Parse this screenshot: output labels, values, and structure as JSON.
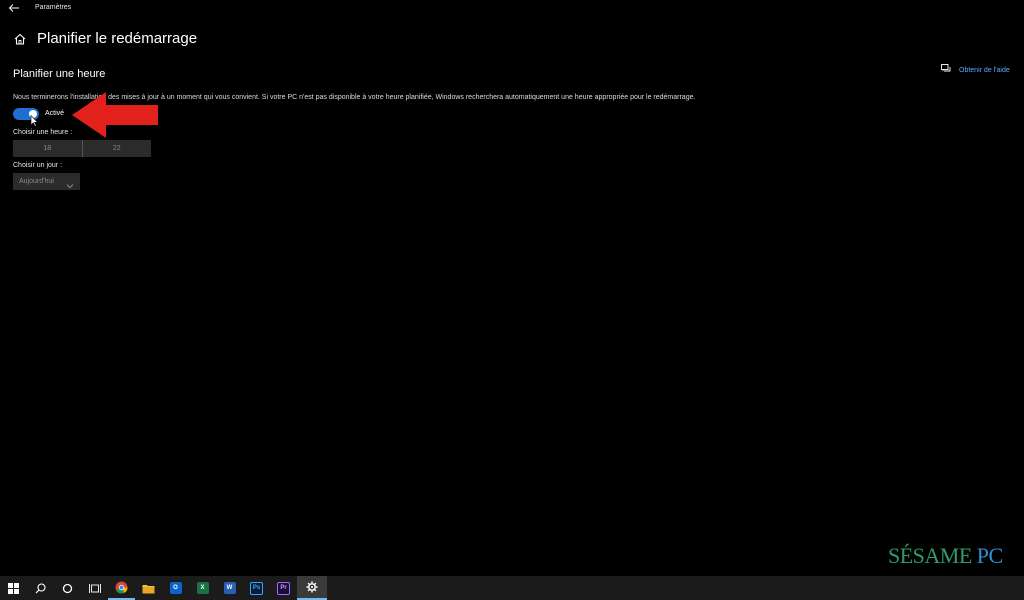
{
  "window": {
    "title": "Paramètres"
  },
  "page": {
    "title": "Planifier le redémarrage"
  },
  "section": {
    "title": "Planifier une heure"
  },
  "help": {
    "label": "Obtenir de l'aide"
  },
  "description": "Nous terminerons l'installation des mises à jour à un moment qui vous convient. Si votre PC n'est pas disponible à votre heure planifiée, Windows recherchera automatiquement une heure appropriée pour le redémarrage.",
  "toggle": {
    "label": "Activé",
    "on": true
  },
  "time": {
    "label": "Choisir une heure :",
    "hour": "18",
    "minute": "22"
  },
  "day": {
    "label": "Choisir un jour :",
    "value": "Aujourd'hui"
  },
  "watermark": {
    "part1": "SÉSAME",
    "part2": "PC"
  },
  "colors": {
    "accent": "#1f6fd3",
    "background": "#000000",
    "link": "#5aa9ff",
    "annotation_arrow": "#e3211c",
    "watermark_green": "#2e9b6b",
    "watermark_blue": "#2f8fd0"
  },
  "taskbar": {
    "items": [
      {
        "name": "start-icon"
      },
      {
        "name": "search-icon"
      },
      {
        "name": "cortana-icon"
      },
      {
        "name": "task-view-icon"
      },
      {
        "name": "chrome-icon"
      },
      {
        "name": "file-explorer-icon"
      },
      {
        "name": "outlook-icon",
        "text": "O"
      },
      {
        "name": "excel-icon",
        "text": "X"
      },
      {
        "name": "word-icon",
        "text": "W"
      },
      {
        "name": "photoshop-icon",
        "text": "Ps"
      },
      {
        "name": "premiere-icon",
        "text": "Pr"
      },
      {
        "name": "settings-icon"
      }
    ]
  }
}
